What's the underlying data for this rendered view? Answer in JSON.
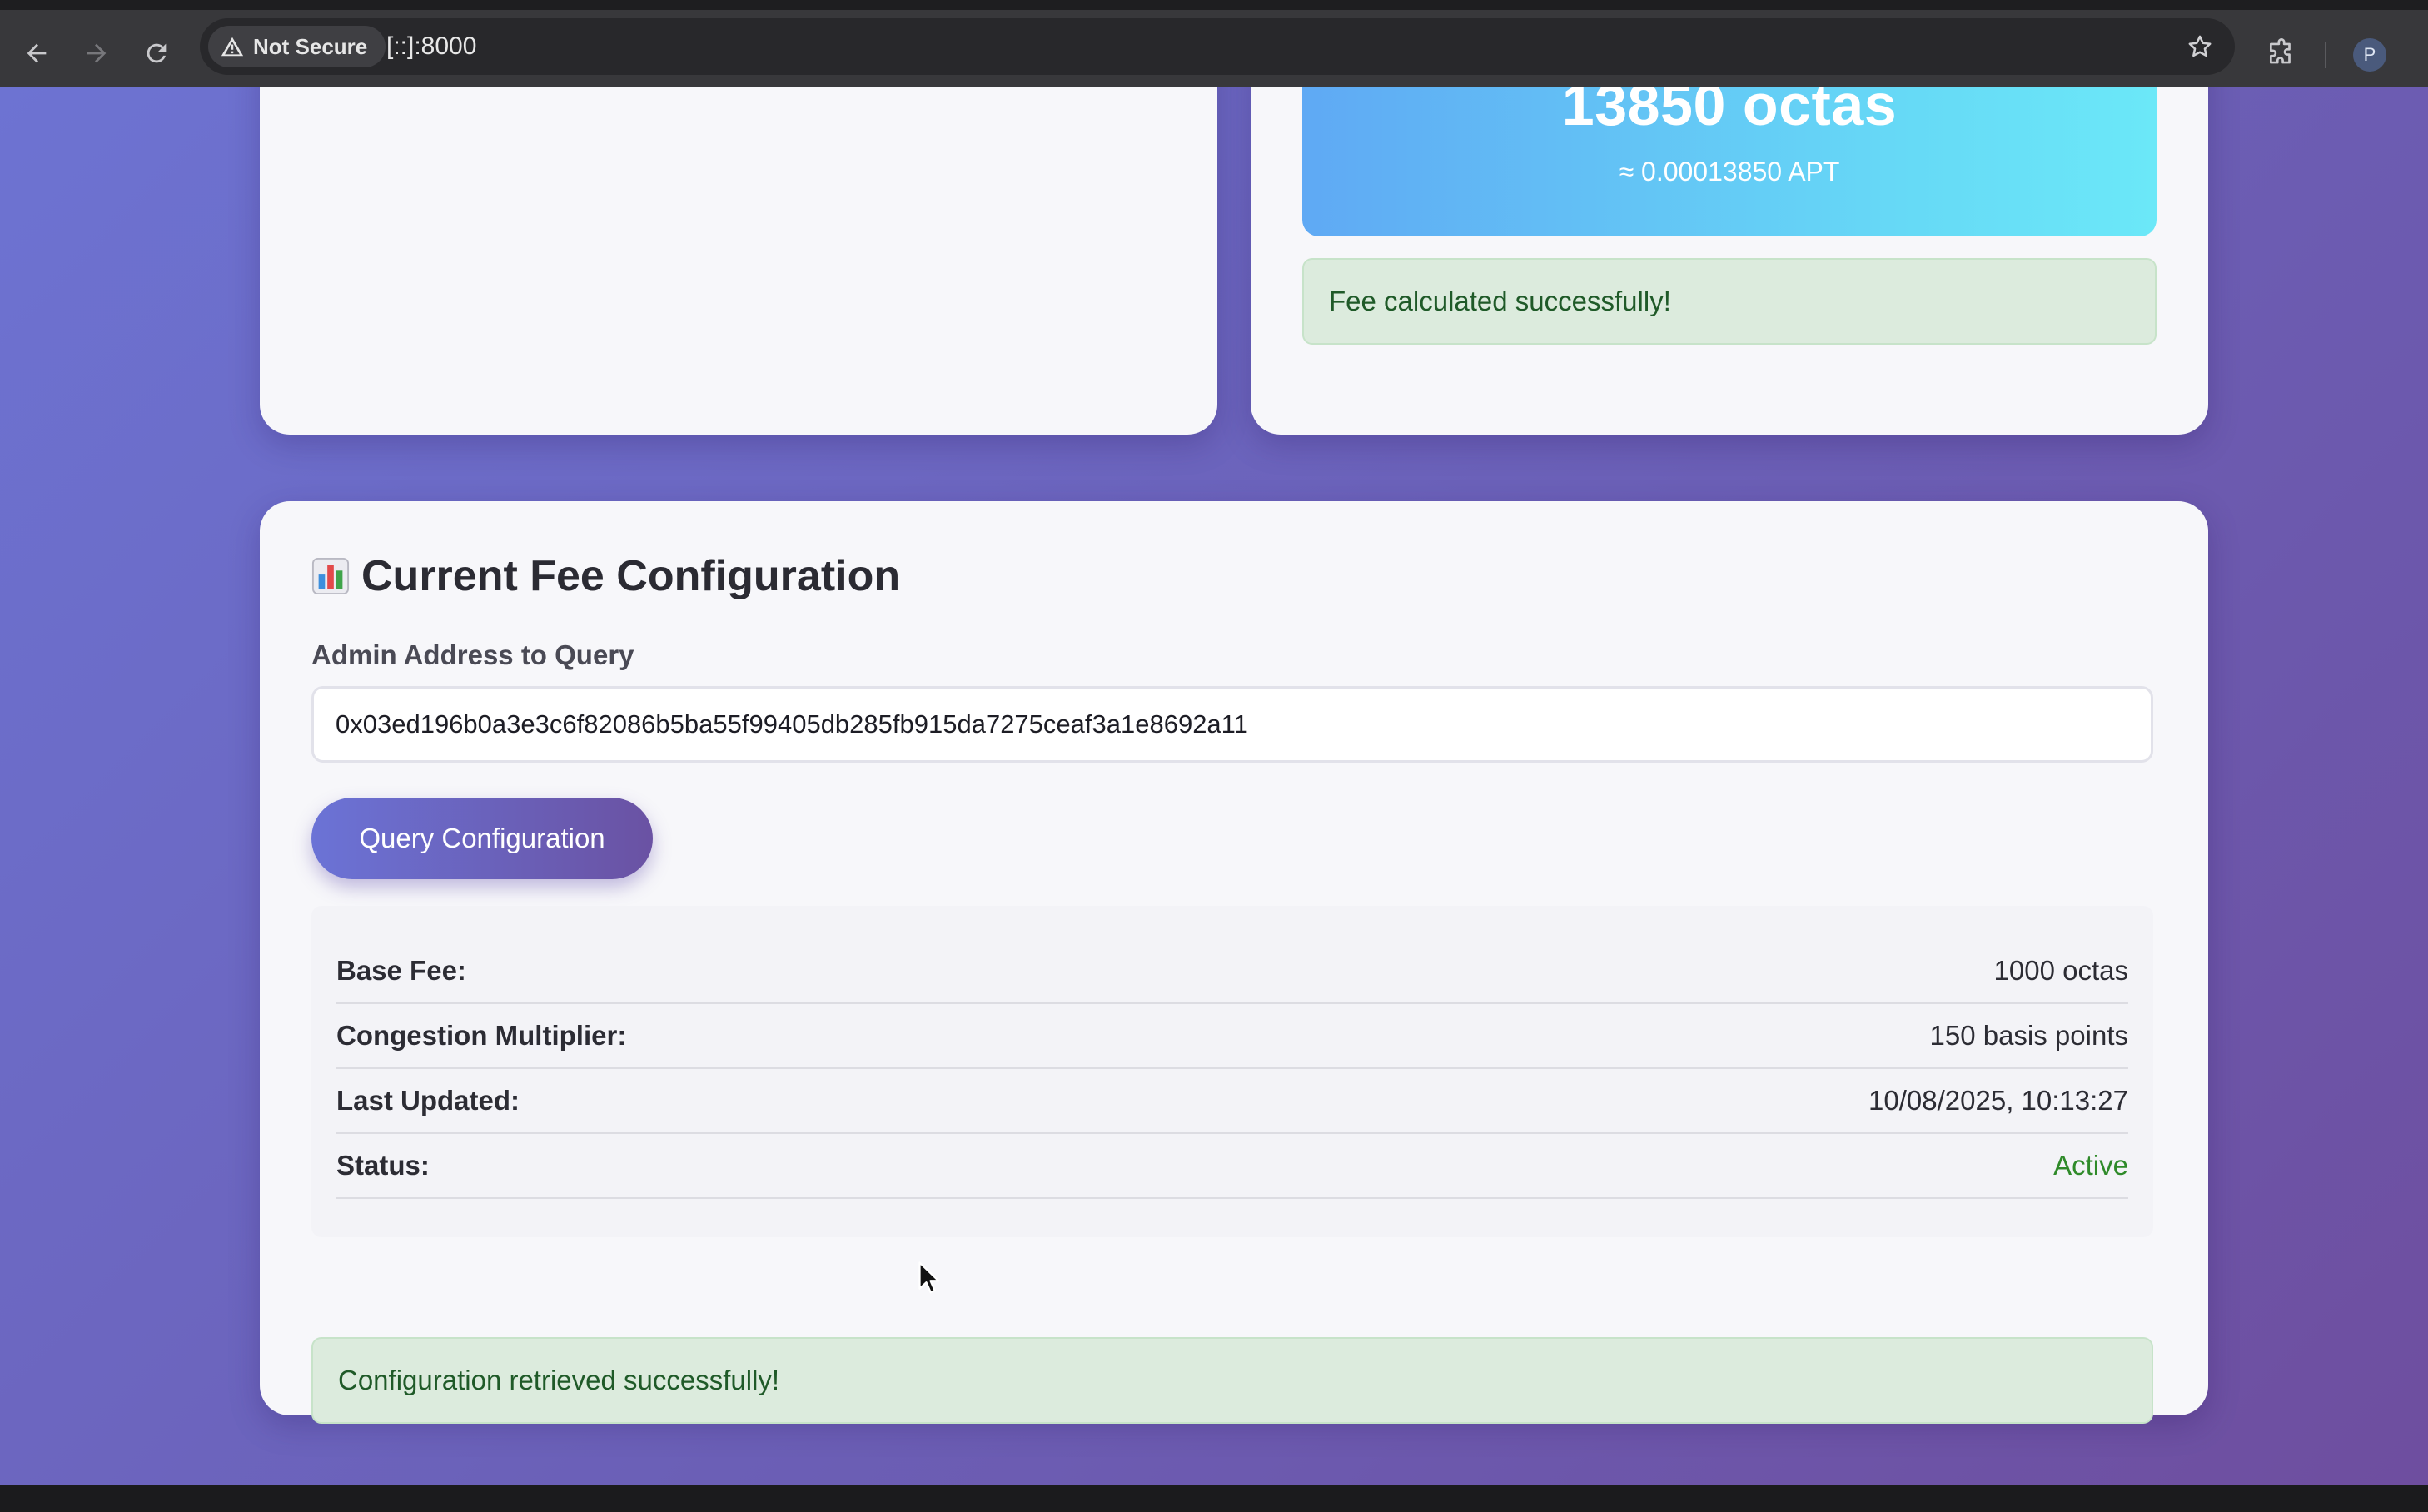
{
  "browser": {
    "security_label": "Not Secure",
    "url": "[::]:8000",
    "profile_initial": "P"
  },
  "fee_result": {
    "octas": "13850 octas",
    "apt": "≈ 0.00013850 APT",
    "message": "Fee calculated successfully!"
  },
  "config": {
    "title": "Current Fee Configuration",
    "title_icon": "bar-chart-icon",
    "address_label": "Admin Address to Query",
    "address_value": "0x03ed196b0a3e3c6f82086b5ba55f99405db285fb915da7275ceaf3a1e8692a11",
    "query_button": "Query Configuration",
    "rows": [
      {
        "label": "Base Fee:",
        "value": "1000 octas"
      },
      {
        "label": "Congestion Multiplier:",
        "value": "150 basis points"
      },
      {
        "label": "Last Updated:",
        "value": "10/08/2025, 10:13:27"
      },
      {
        "label": "Status:",
        "value": "Active"
      }
    ],
    "message": "Configuration retrieved successfully!"
  },
  "colors": {
    "page_gradient_start": "#6d73d2",
    "page_gradient_end": "#6e4e9f",
    "fee_gradient_start": "#5fa9f4",
    "fee_gradient_end": "#6be8f8",
    "success_bg": "#dcebdd",
    "success_text": "#1f5a28",
    "status_active": "#2f8a2a"
  }
}
